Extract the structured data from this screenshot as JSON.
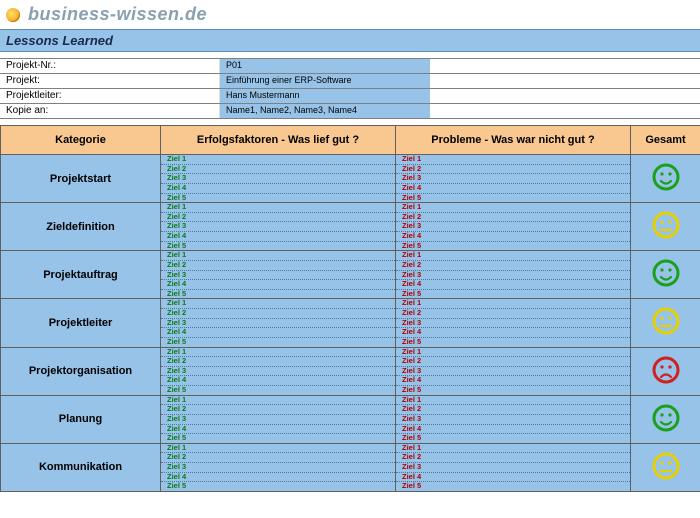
{
  "site": "business-wissen.de",
  "title": "Lessons Learned",
  "meta": [
    {
      "label": "Projekt-Nr.:",
      "value": "P01"
    },
    {
      "label": "Projekt:",
      "value": "Einführung einer ERP-Software"
    },
    {
      "label": "Projektleiter:",
      "value": "Hans Mustermann"
    },
    {
      "label": "Kopie an:",
      "value": "Name1, Name2, Name3, Name4"
    }
  ],
  "columns": {
    "kategorie": "Kategorie",
    "erfolg": "Erfolgsfaktoren - Was lief gut ?",
    "probleme": "Probleme - Was war nicht gut ?",
    "gesamt": "Gesamt"
  },
  "goal_labels": [
    "Ziel 1",
    "Ziel 2",
    "Ziel 3",
    "Ziel 4",
    "Ziel 5"
  ],
  "rows": [
    {
      "kategorie": "Projektstart",
      "mood": "happy-green"
    },
    {
      "kategorie": "Zieldefinition",
      "mood": "neutral-yellow"
    },
    {
      "kategorie": "Projektauftrag",
      "mood": "happy-green"
    },
    {
      "kategorie": "Projektleiter",
      "mood": "neutral-yellow"
    },
    {
      "kategorie": "Projektorganisation",
      "mood": "sad-red"
    },
    {
      "kategorie": "Planung",
      "mood": "happy-green"
    },
    {
      "kategorie": "Kommunikation",
      "mood": "neutral-yellow"
    }
  ],
  "colors": {
    "header_bg": "#f8c890",
    "cell_bg": "#97c3e8",
    "green": "#1aa01a",
    "yellow": "#e8d000",
    "red": "#d02020"
  }
}
